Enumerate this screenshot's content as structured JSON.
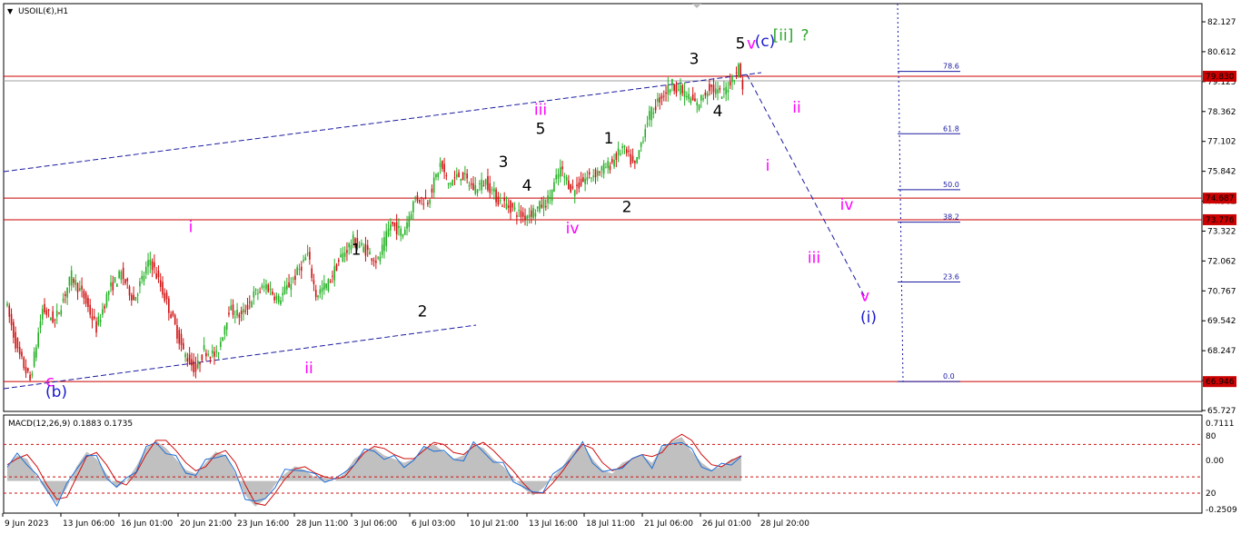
{
  "symbol_title": "USOIL(€),H1",
  "macd": {
    "title": "MACD(12,26,9) 0.1883 0.1735",
    "scale_labels": [
      "0.7111",
      "80",
      "0.00",
      "20",
      "-0.2509"
    ]
  },
  "chart_data": {
    "type": "candlestick",
    "x_tick_labels": [
      "9 Jun 2023",
      "13 Jun 06:00",
      "16 Jun 01:00",
      "20 Jun 21:00",
      "23 Jun 16:00",
      "28 Jun 11:00",
      "3 Jul 06:00",
      "6 Jul 03:00",
      "10 Jul 21:00",
      "13 Jul 16:00",
      "18 Jul 11:00",
      "21 Jul 06:00",
      "26 Jul 01:00",
      "28 Jul 20:00"
    ],
    "y_tick_labels": [
      "82.127",
      "80.612",
      "79.125",
      "78.362",
      "77.102",
      "75.842",
      "74.582",
      "73.322",
      "72.062",
      "70.767",
      "69.542",
      "68.247",
      "67.022",
      "65.727"
    ],
    "ylim": [
      65.727,
      82.127
    ],
    "price_levels": [
      {
        "label": "79.830",
        "value": 79.83,
        "color": "#cc0000"
      },
      {
        "label": "74.687",
        "value": 74.687,
        "color": "#cc0000"
      },
      {
        "label": "73.776",
        "value": 73.776,
        "color": "#cc0000"
      },
      {
        "label": "66.946",
        "value": 66.946,
        "color": "#cc0000"
      }
    ],
    "fib_levels": [
      "78.6",
      "61.8",
      "50.0",
      "38.2",
      "23.6",
      "0.0"
    ],
    "path_points": [
      [
        0,
        70.4
      ],
      [
        6,
        68.2
      ],
      [
        12,
        67.0
      ],
      [
        18,
        70.0
      ],
      [
        24,
        69.5
      ],
      [
        32,
        71.4
      ],
      [
        38,
        70.5
      ],
      [
        44,
        69.2
      ],
      [
        50,
        70.8
      ],
      [
        56,
        71.5
      ],
      [
        62,
        70.4
      ],
      [
        70,
        72.1
      ],
      [
        74,
        71.2
      ],
      [
        80,
        69.8
      ],
      [
        86,
        68.2
      ],
      [
        92,
        67.4
      ],
      [
        96,
        68.3
      ],
      [
        102,
        68.0
      ],
      [
        108,
        70.0
      ],
      [
        114,
        69.7
      ],
      [
        120,
        70.6
      ],
      [
        126,
        71.0
      ],
      [
        132,
        70.4
      ],
      [
        140,
        71.4
      ],
      [
        146,
        72.3
      ],
      [
        150,
        70.6
      ],
      [
        156,
        71.1
      ],
      [
        162,
        72.2
      ],
      [
        168,
        72.9
      ],
      [
        174,
        72.5
      ],
      [
        180,
        72.0
      ],
      [
        186,
        73.6
      ],
      [
        192,
        73.2
      ],
      [
        198,
        74.7
      ],
      [
        204,
        74.6
      ],
      [
        210,
        76.1
      ],
      [
        214,
        75.3
      ],
      [
        220,
        75.7
      ],
      [
        226,
        75.1
      ],
      [
        232,
        75.4
      ],
      [
        238,
        74.6
      ],
      [
        244,
        74.3
      ],
      [
        250,
        73.9
      ],
      [
        256,
        74.2
      ],
      [
        262,
        74.6
      ],
      [
        268,
        75.9
      ],
      [
        274,
        75.0
      ],
      [
        280,
        75.5
      ],
      [
        286,
        75.8
      ],
      [
        292,
        76.1
      ],
      [
        298,
        76.8
      ],
      [
        304,
        76.0
      ],
      [
        310,
        78.0
      ],
      [
        316,
        78.9
      ],
      [
        322,
        79.5
      ],
      [
        328,
        79.1
      ],
      [
        334,
        78.6
      ],
      [
        340,
        79.4
      ],
      [
        346,
        79.0
      ],
      [
        350,
        79.6
      ],
      [
        354,
        80.2
      ],
      [
        356,
        79.4
      ]
    ],
    "macd_series": [
      0.2,
      0.35,
      0.3,
      0.05,
      -0.15,
      -0.3,
      -0.1,
      0.2,
      0.4,
      0.3,
      0.1,
      -0.1,
      0.0,
      0.2,
      0.45,
      0.55,
      0.45,
      0.3,
      0.15,
      0.1,
      0.25,
      0.4,
      0.35,
      0.1,
      -0.2,
      -0.35,
      -0.25,
      -0.05,
      0.1,
      0.2,
      0.15,
      0.05,
      0.05,
      0.0,
      0.1,
      0.3,
      0.4,
      0.45,
      0.35,
      0.3,
      0.25,
      0.3,
      0.45,
      0.5,
      0.4,
      0.3,
      0.35,
      0.5,
      0.45,
      0.3,
      0.2,
      0.05,
      -0.1,
      -0.2,
      -0.1,
      0.05,
      0.2,
      0.4,
      0.5,
      0.3,
      0.15,
      0.1,
      0.25,
      0.3,
      0.35,
      0.25,
      0.45,
      0.55,
      0.6,
      0.4,
      0.25,
      0.15,
      0.2,
      0.3,
      0.32
    ],
    "wave_labels": [
      {
        "text": "c",
        "color": "#ff00ff",
        "x": 55,
        "v": 66.75
      },
      {
        "text": "(b)",
        "color": "#1a1ad0",
        "x": 62,
        "v": 66.3
      },
      {
        "text": "i",
        "color": "#ff00ff",
        "x": 210,
        "v": 73.25
      },
      {
        "text": "ii",
        "color": "#ff00ff",
        "x": 340,
        "v": 67.3
      },
      {
        "text": "1",
        "color": "#000000",
        "x": 392,
        "v": 72.3
      },
      {
        "text": "2",
        "color": "#000000",
        "x": 465,
        "v": 69.7
      },
      {
        "text": "iii",
        "color": "#ff00ff",
        "x": 595,
        "v": 78.2
      },
      {
        "text": "5",
        "color": "#000000",
        "x": 595,
        "v": 77.4
      },
      {
        "text": "3",
        "color": "#000000",
        "x": 554,
        "v": 76.0
      },
      {
        "text": "4",
        "color": "#000000",
        "x": 580,
        "v": 75.0
      },
      {
        "text": "iv",
        "color": "#ff00ff",
        "x": 630,
        "v": 73.2
      },
      {
        "text": "1",
        "color": "#000000",
        "x": 670,
        "v": 77.0
      },
      {
        "text": "2",
        "color": "#000000",
        "x": 690,
        "v": 74.1
      },
      {
        "text": "3",
        "color": "#000000",
        "x": 764,
        "v": 80.35
      },
      {
        "text": "4",
        "color": "#000000",
        "x": 790,
        "v": 78.15
      },
      {
        "text": "5",
        "color": "#000000",
        "x": 815,
        "v": 81.0
      },
      {
        "text": "v",
        "color": "#ff00ff",
        "x": 827,
        "v": 81.0
      },
      {
        "text": "(c)",
        "color": "#1a1ad0",
        "x": 842,
        "v": 81.1
      },
      {
        "text": "[ii]",
        "color": "#2ea52e",
        "x": 862,
        "v": 81.35
      },
      {
        "text": "?",
        "color": "#2ea52e",
        "x": 886,
        "v": 81.35
      },
      {
        "text": "ii",
        "color": "#ff00ff",
        "x": 877,
        "v": 78.3
      },
      {
        "text": "i",
        "color": "#ff00ff",
        "x": 845,
        "v": 75.85
      },
      {
        "text": "iv",
        "color": "#ff00ff",
        "x": 932,
        "v": 74.2
      },
      {
        "text": "iii",
        "color": "#ff00ff",
        "x": 896,
        "v": 71.95
      },
      {
        "text": "v",
        "color": "#ff00ff",
        "x": 952,
        "v": 70.35
      },
      {
        "text": "(i)",
        "color": "#1a1ad0",
        "x": 956,
        "v": 69.45
      }
    ]
  }
}
